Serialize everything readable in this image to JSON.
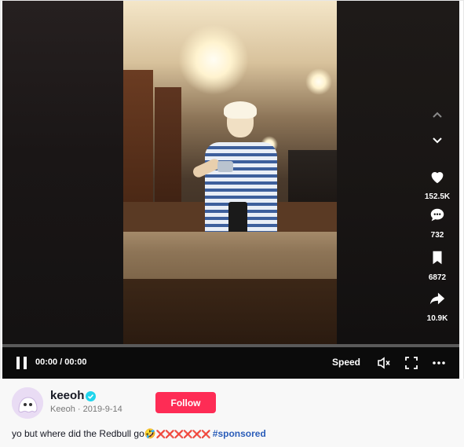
{
  "video": {
    "time_display": "00:00 / 00:00",
    "progress": 0,
    "speed_label": "Speed"
  },
  "side_actions": {
    "likes": "152.5K",
    "comments": "732",
    "saves": "6872",
    "shares": "10.9K"
  },
  "author": {
    "username": "keeoh",
    "nickname": "Keeoh",
    "date": "2019-9-14",
    "verified": true
  },
  "follow_label": "Follow",
  "caption": {
    "text": "yo but where did the Redbull go",
    "emoji": "🤣",
    "tail": "❌❌❌❌❌❌",
    "hashtag": "#sponsored"
  },
  "colors": {
    "follow_bg": "#fe2c55",
    "hashtag": "#2b5db9",
    "verified": "#20d5ec"
  },
  "icons": [
    "chevron-up-icon",
    "chevron-down-icon",
    "heart-icon",
    "comment-icon",
    "bookmark-icon",
    "share-icon",
    "pause-icon",
    "volume-icon",
    "fullscreen-icon",
    "more-icon",
    "verified-icon"
  ]
}
